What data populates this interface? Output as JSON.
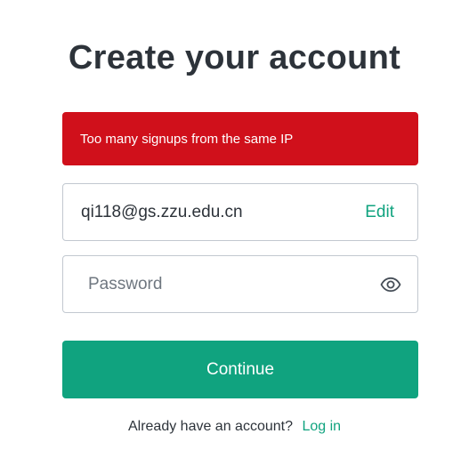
{
  "page": {
    "title": "Create your account"
  },
  "error": {
    "message": "Too many signups from the same IP",
    "color": "#d0101b"
  },
  "email": {
    "value": "qi118@gs.zzu.edu.cn",
    "edit_label": "Edit"
  },
  "password": {
    "placeholder": "Password",
    "toggle_icon": "eye-icon"
  },
  "continue": {
    "label": "Continue",
    "color": "#10a37f"
  },
  "login": {
    "prompt": "Already have an account?",
    "link_label": "Log in"
  }
}
